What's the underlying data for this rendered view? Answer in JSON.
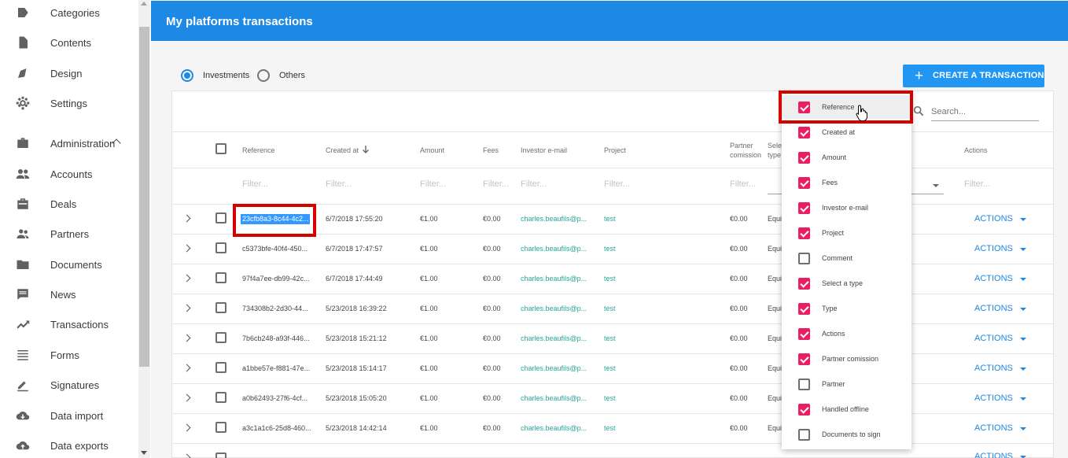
{
  "sidebar": {
    "items": [
      {
        "label": "Categories",
        "icon": "tag-icon"
      },
      {
        "label": "Contents",
        "icon": "document-icon"
      },
      {
        "label": "Design",
        "icon": "brush-icon"
      },
      {
        "label": "Settings",
        "icon": "gear-icon"
      },
      {
        "label": "Administration",
        "icon": "briefcase-icon"
      },
      {
        "label": "Accounts",
        "icon": "people-icon"
      },
      {
        "label": "Deals",
        "icon": "suitcase-icon"
      },
      {
        "label": "Partners",
        "icon": "partners-icon"
      },
      {
        "label": "Documents",
        "icon": "folder-icon"
      },
      {
        "label": "News",
        "icon": "chat-icon"
      },
      {
        "label": "Transactions",
        "icon": "trending-up-icon"
      },
      {
        "label": "Forms",
        "icon": "lines-icon"
      },
      {
        "label": "Signatures",
        "icon": "pen-icon"
      },
      {
        "label": "Data import",
        "icon": "cloud-download-icon"
      },
      {
        "label": "Data exports",
        "icon": "cloud-upload-icon"
      }
    ]
  },
  "header": {
    "title": "My platforms transactions"
  },
  "toolbar": {
    "radio_investments": "Investments",
    "radio_others": "Others",
    "selected_radio": "Investments",
    "create_button": "CREATE A TRANSACTION",
    "search_placeholder": "Search..."
  },
  "table": {
    "headers": {
      "reference": "Reference",
      "created_at": "Created at",
      "amount": "Amount",
      "fees": "Fees",
      "investor_email": "Investor e-mail",
      "project": "Project",
      "partner_comission_1": "Partner",
      "partner_comission_2": "comission",
      "select_type_1": "Sele",
      "select_type_2": "type",
      "actions": "Actions"
    },
    "filter_placeholder": "Filter...",
    "actions_label": "ACTIONS",
    "rows": [
      {
        "reference": "23cfb8a3-8c44-4c2...",
        "created_at": "6/7/2018 17:55:20",
        "amount": "€1.00",
        "fees": "€0.00",
        "email": "charles.beaufils@p...",
        "project": "test",
        "partner_comission": "€0.00",
        "type": "Equi"
      },
      {
        "reference": "c5373bfe-40f4-450...",
        "created_at": "6/7/2018 17:47:57",
        "amount": "€1.00",
        "fees": "€0.00",
        "email": "charles.beaufils@p...",
        "project": "test",
        "partner_comission": "€0.00",
        "type": "Equi"
      },
      {
        "reference": "97f4a7ee-db99-42c...",
        "created_at": "6/7/2018 17:44:49",
        "amount": "€1.00",
        "fees": "€0.00",
        "email": "charles.beaufils@p...",
        "project": "test",
        "partner_comission": "€0.00",
        "type": "Equi"
      },
      {
        "reference": "734308b2-2d30-44...",
        "created_at": "5/23/2018 16:39:22",
        "amount": "€1.00",
        "fees": "€0.00",
        "email": "charles.beaufils@p...",
        "project": "test",
        "partner_comission": "€0.00",
        "type": "Equi"
      },
      {
        "reference": "7b6cb248-a93f-446...",
        "created_at": "5/23/2018 15:21:12",
        "amount": "€1.00",
        "fees": "€0.00",
        "email": "charles.beaufils@p...",
        "project": "test",
        "partner_comission": "€0.00",
        "type": "Equi"
      },
      {
        "reference": "a1bbe57e-f881-47e...",
        "created_at": "5/23/2018 15:14:17",
        "amount": "€1.00",
        "fees": "€0.00",
        "email": "charles.beaufils@p...",
        "project": "test",
        "partner_comission": "€0.00",
        "type": "Equi"
      },
      {
        "reference": "a0b62493-27f6-4cf...",
        "created_at": "5/23/2018 15:05:20",
        "amount": "€1.00",
        "fees": "€0.00",
        "email": "charles.beaufils@p...",
        "project": "test",
        "partner_comission": "€0.00",
        "type": "Equi"
      },
      {
        "reference": "a3c1a1c6-25d8-460...",
        "created_at": "5/23/2018 14:42:14",
        "amount": "€1.00",
        "fees": "€0.00",
        "email": "charles.beaufils@p...",
        "project": "test",
        "partner_comission": "€0.00",
        "type": "Equi"
      }
    ]
  },
  "column_menu": {
    "items": [
      {
        "label": "Reference",
        "checked": true
      },
      {
        "label": "Created at",
        "checked": true
      },
      {
        "label": "Amount",
        "checked": true
      },
      {
        "label": "Fees",
        "checked": true
      },
      {
        "label": "Investor e-mail",
        "checked": true
      },
      {
        "label": "Project",
        "checked": true
      },
      {
        "label": "Comment",
        "checked": false
      },
      {
        "label": "Select a type",
        "checked": true
      },
      {
        "label": "Type",
        "checked": true
      },
      {
        "label": "Actions",
        "checked": true
      },
      {
        "label": "Partner comission",
        "checked": true
      },
      {
        "label": "Partner",
        "checked": false
      },
      {
        "label": "Handled offline",
        "checked": true
      },
      {
        "label": "Documents to sign",
        "checked": false
      }
    ]
  },
  "colors": {
    "header": "#1e88e5",
    "accent": "#2196f3",
    "checkbox_on": "#e91e63",
    "link": "#26a69a",
    "highlight": "#d50000"
  }
}
